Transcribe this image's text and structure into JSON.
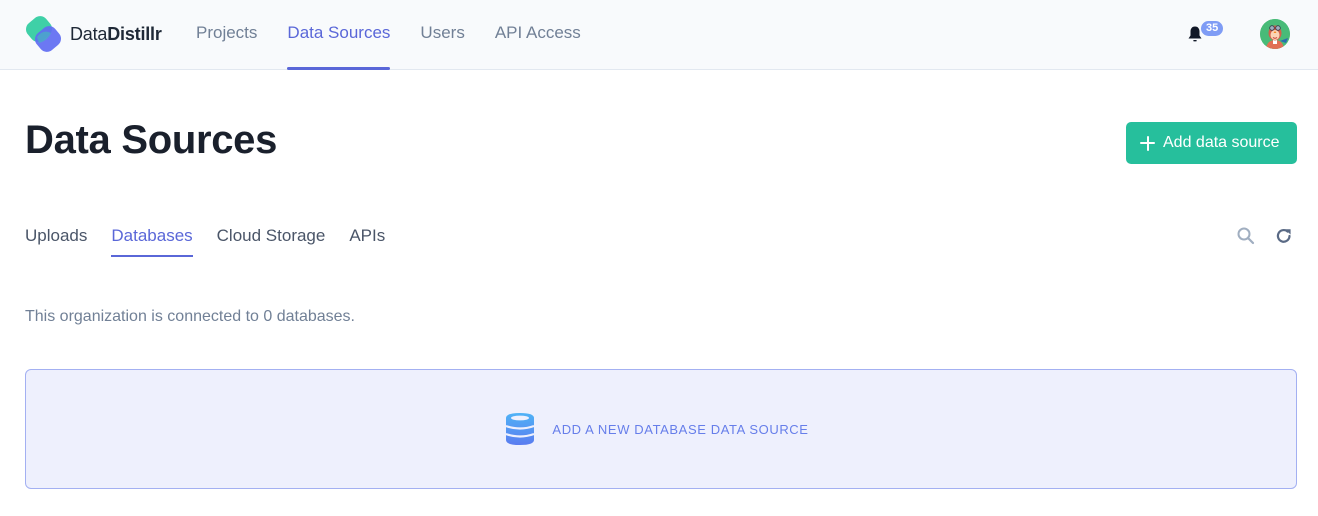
{
  "app": {
    "brand_light": "Data",
    "brand_bold": "Distillr"
  },
  "nav": {
    "items": [
      {
        "label": "Projects",
        "active": false
      },
      {
        "label": "Data Sources",
        "active": true
      },
      {
        "label": "Users",
        "active": false
      },
      {
        "label": "API Access",
        "active": false
      }
    ]
  },
  "header": {
    "notification_icon": "bell-icon",
    "notification_count": "35",
    "avatar_icon": "user-avatar"
  },
  "page": {
    "title": "Data Sources",
    "add_button_label": "Add data source",
    "add_button_icon": "plus-icon"
  },
  "tabs": {
    "items": [
      {
        "label": "Uploads",
        "active": false
      },
      {
        "label": "Databases",
        "active": true
      },
      {
        "label": "Cloud Storage",
        "active": false
      },
      {
        "label": "APIs",
        "active": false
      }
    ],
    "search_icon": "search-icon",
    "refresh_icon": "refresh-icon"
  },
  "content": {
    "description": "This organization is connected to 0 databases.",
    "empty_state_label": "ADD A NEW DATABASE DATA SOURCE",
    "empty_state_icon": "database-icon"
  },
  "colors": {
    "accent": "#5a67d8",
    "primary_button": "#26bf9c",
    "badge": "#7f9cf5",
    "empty_card_bg": "#eef0fd",
    "empty_card_border": "#a3b0f2"
  }
}
